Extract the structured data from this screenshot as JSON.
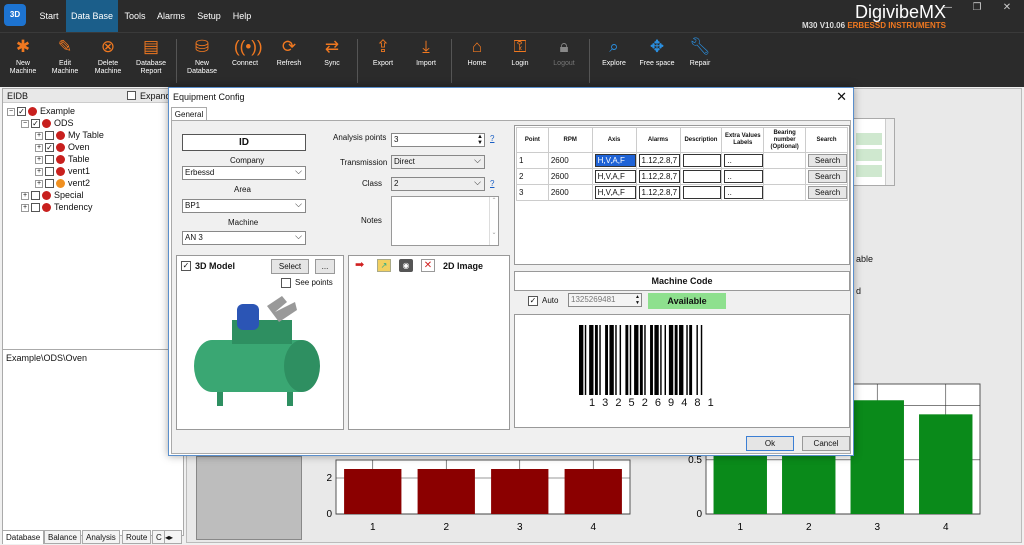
{
  "app": {
    "logo_text": "3D",
    "brand": "DigivibeMX",
    "version": "M30 V10.06",
    "vendor": "ERBESSD INSTRUMENTS"
  },
  "menu": [
    "Start",
    "Data Base",
    "Tools",
    "Alarms",
    "Setup",
    "Help"
  ],
  "toolbar": [
    {
      "label": "New\nMachine",
      "icon": "new-machine-icon"
    },
    {
      "label": "Edit\nMachine",
      "icon": "pencil-icon"
    },
    {
      "label": "Delete\nMachine",
      "icon": "delete-icon"
    },
    {
      "label": "Database\nReport",
      "icon": "report-icon"
    },
    {
      "label": "New\nDatabase",
      "icon": "database-icon"
    },
    {
      "label": "Connect",
      "icon": "wireless-icon"
    },
    {
      "label": "Refresh",
      "icon": "refresh-icon"
    },
    {
      "label": "Sync",
      "icon": "sync-icon"
    },
    {
      "label": "Export",
      "icon": "export-icon"
    },
    {
      "label": "Import",
      "icon": "import-icon"
    },
    {
      "label": "Home",
      "icon": "home-icon"
    },
    {
      "label": "Login",
      "icon": "key-icon"
    },
    {
      "label": "Logout",
      "icon": "lock-icon"
    },
    {
      "label": "Explore",
      "icon": "magnifier-icon"
    },
    {
      "label": "Free space",
      "icon": "arrows-icon"
    },
    {
      "label": "Repair",
      "icon": "wrench-icon"
    }
  ],
  "left_panel": {
    "header": "EIDB",
    "expand_label": "Expand",
    "tree": [
      {
        "label": "Example",
        "checked": true
      },
      {
        "label": "ODS",
        "checked": true
      },
      {
        "label": "My Table",
        "checked": false
      },
      {
        "label": "Oven",
        "checked": true
      },
      {
        "label": "Table",
        "checked": false
      },
      {
        "label": "vent1",
        "checked": false
      },
      {
        "label": "vent2",
        "checked": false
      },
      {
        "label": "Special",
        "checked": false
      },
      {
        "label": "Tendency",
        "checked": false
      }
    ],
    "path": "Example\\ODS\\Oven",
    "tabs": [
      "Database",
      "Balance",
      "Analysis",
      "Route",
      "C"
    ]
  },
  "background": {
    "right_text_1": "able",
    "right_text_2": "d"
  },
  "chart_data": [
    {
      "type": "bar",
      "categories": [
        "1",
        "2",
        "3",
        "4"
      ],
      "values": [
        2.5,
        2.5,
        2.5,
        2.5
      ],
      "title": "",
      "xlabel": "",
      "ylabel": "",
      "yticks": [
        "0",
        "2"
      ],
      "ylim": [
        0,
        3
      ],
      "color": "#8b0000"
    },
    {
      "type": "bar",
      "categories": [
        "1",
        "2",
        "3",
        "4"
      ],
      "values": [
        0.9,
        0.9,
        1.05,
        0.92
      ],
      "title": "",
      "xlabel": "",
      "ylabel": "",
      "yticks": [
        "0",
        "0.5",
        "1"
      ],
      "ylim": [
        0,
        1.2
      ],
      "color": "#0a8a1a"
    }
  ],
  "dialog": {
    "title": "Equipment Config",
    "tab": "General",
    "id_label": "ID",
    "company_label": "Company",
    "company_value": "Erbessd",
    "area_label": "Area",
    "area_value": "BP1",
    "machine_label": "Machine",
    "machine_value": "AN 3",
    "analysis_points_label": "Analysis points",
    "analysis_points_value": "3",
    "transmission_label": "Transmission",
    "transmission_value": "Direct",
    "class_label": "Class",
    "class_value": "2",
    "notes_label": "Notes",
    "help": "?",
    "model_label": "3D Model",
    "select_label": "Select",
    "ellipsis_label": "...",
    "see_points_label": "See points",
    "image_label": "2D Image",
    "table": {
      "headers": [
        "Point",
        "RPM",
        "Axis",
        "Alarms",
        "Description",
        "Extra Values Labels",
        "Bearing number (Optional)",
        "Search"
      ],
      "rows": [
        {
          "point": "1",
          "rpm": "2600",
          "axis": "H,V,A,F",
          "alarms": "1.12,2.8,7",
          "desc": "",
          "extra": "..",
          "bearing": "",
          "search": "Search"
        },
        {
          "point": "2",
          "rpm": "2600",
          "axis": "H,V,A,F",
          "alarms": "1.12,2.8,7",
          "desc": "",
          "extra": "..",
          "bearing": "",
          "search": "Search"
        },
        {
          "point": "3",
          "rpm": "2600",
          "axis": "H,V,A,F",
          "alarms": "1.12,2.8,7",
          "desc": "",
          "extra": "..",
          "bearing": "",
          "search": "Search"
        }
      ]
    },
    "machine_code_label": "Machine Code",
    "auto_label": "Auto",
    "code_value": "1325269481",
    "available_label": "Available",
    "barcode_digits": "1 3 2 5 2 6 9 4 8 1",
    "ok_label": "Ok",
    "cancel_label": "Cancel",
    "colors": {
      "available": "#8ee08e",
      "accent": "#1f63d6"
    }
  }
}
